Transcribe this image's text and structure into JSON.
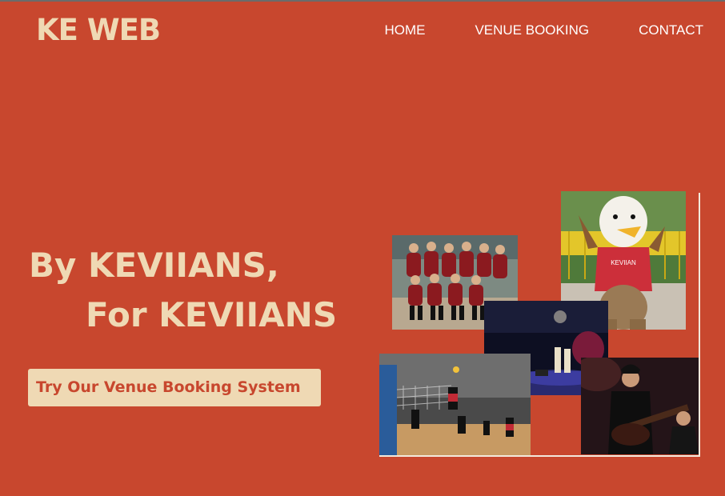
{
  "header": {
    "logo": "KE WEB",
    "nav": [
      {
        "label": "HOME"
      },
      {
        "label": "VENUE BOOKING"
      },
      {
        "label": "CONTACT"
      }
    ]
  },
  "hero": {
    "line1": "By KEVIIANS,",
    "line2": "For KEVIIANS",
    "cta_label": "Try Our Venue Booking System"
  },
  "collage": {
    "photos": [
      {
        "subject": "team-group-photo"
      },
      {
        "subject": "eagle-mascot"
      },
      {
        "subject": "stage-performance"
      },
      {
        "subject": "volleyball-match"
      },
      {
        "subject": "guitarist-performance"
      }
    ],
    "mascot_shirt_text": "KEVIIAN"
  },
  "colors": {
    "background": "#c8472e",
    "accent": "#efd9b4"
  }
}
